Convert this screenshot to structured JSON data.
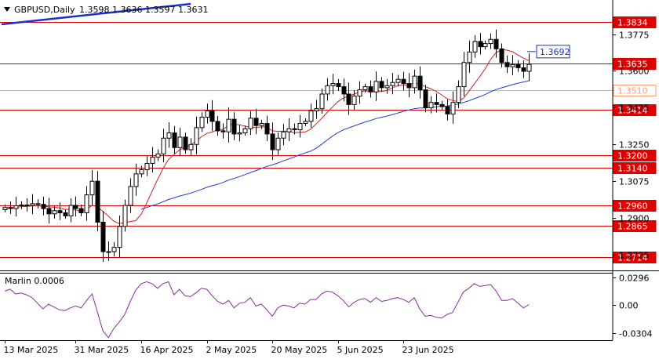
{
  "header": {
    "symbol_label": "GBPUSD,Daily",
    "ohlc_label": "1.3598 1.3636 1.3597 1.3631",
    "indicator_label": "Marlin 0.0006"
  },
  "colors": {
    "bull_candle": "#ffffff",
    "bear_candle": "#000000",
    "level_line": "#e00000",
    "level_tag": "#e00000",
    "soft_level_line": "#ff9d7a",
    "ma_fast": "#d61f1f",
    "ma_slow": "#1f3fd6",
    "trend_line": "#1a2fd0",
    "oscillator": "#8a2d9a",
    "target_tag_border": "#1a2fd0"
  },
  "chart_data": [
    {
      "type": "candlestick",
      "title": "GBPUSD,Daily",
      "ylim": [
        1.2658,
        1.393
      ],
      "y_ticks": [
        "1.3775",
        "1.3600",
        "1.3425",
        "1.3250",
        "1.3075",
        "1.2900",
        "1.2725"
      ],
      "y_tick_values": [
        1.3775,
        1.36,
        1.3425,
        1.325,
        1.3075,
        1.29,
        1.2725
      ],
      "x_labels": [
        "13 Mar 2025",
        "31 Mar 2025",
        "16 Apr 2025",
        "2 May 2025",
        "20 May 2025",
        "5 Jun 2025",
        "23 Jun 2025"
      ],
      "x_label_indices": [
        0,
        13,
        25,
        37,
        49,
        61,
        73
      ],
      "levels": [
        {
          "label": "1.3834",
          "value": 1.3834,
          "style": "strong"
        },
        {
          "label": "1.3635",
          "value": 1.3635,
          "style": "strong"
        },
        {
          "label": "1.3510",
          "value": 1.351,
          "style": "soft"
        },
        {
          "label": "1.3414",
          "value": 1.3414,
          "style": "strong"
        },
        {
          "label": "1.3200",
          "value": 1.32,
          "style": "strong"
        },
        {
          "label": "1.3140",
          "value": 1.314,
          "style": "strong"
        },
        {
          "label": "1.2960",
          "value": 1.296,
          "style": "strong"
        },
        {
          "label": "1.2865",
          "value": 1.2865,
          "style": "strong"
        },
        {
          "label": "1.2714",
          "value": 1.2714,
          "style": "strong"
        }
      ],
      "target_label": "1.3692",
      "target_value": 1.3692,
      "closes": [
        1.295,
        1.2945,
        1.2958,
        1.2962,
        1.296,
        1.2968,
        1.2965,
        1.2945,
        1.292,
        1.2935,
        1.2925,
        1.291,
        1.296,
        1.2945,
        1.2925,
        1.301,
        1.3075,
        1.288,
        1.274,
        1.274,
        1.276,
        1.286,
        1.296,
        1.305,
        1.311,
        1.313,
        1.316,
        1.319,
        1.3205,
        1.328,
        1.3305,
        1.3235,
        1.3285,
        1.3225,
        1.325,
        1.333,
        1.338,
        1.341,
        1.336,
        1.3315,
        1.331,
        1.337,
        1.33,
        1.3305,
        1.3325,
        1.3375,
        1.334,
        1.335,
        1.33,
        1.3225,
        1.328,
        1.331,
        1.3325,
        1.332,
        1.335,
        1.336,
        1.341,
        1.342,
        1.349,
        1.353,
        1.354,
        1.3525,
        1.349,
        1.344,
        1.348,
        1.351,
        1.3525,
        1.35,
        1.355,
        1.352,
        1.353,
        1.3545,
        1.356,
        1.354,
        1.352,
        1.3575,
        1.351,
        1.3425,
        1.345,
        1.344,
        1.343,
        1.3395,
        1.345,
        1.3525,
        1.364,
        1.369,
        1.374,
        1.3715,
        1.373,
        1.375,
        1.3705,
        1.364,
        1.362,
        1.363,
        1.3615,
        1.3598,
        1.3631
      ]
    },
    {
      "type": "line",
      "title": "Marlin 0.0006",
      "ylim": [
        -0.036,
        0.033
      ],
      "y_ticks": [
        "0.0296",
        "0.00",
        "-0.0304"
      ],
      "y_tick_values": [
        0.0296,
        0.0,
        -0.0304
      ],
      "series": [
        {
          "values": [
            0.015,
            0.017,
            0.012,
            0.013,
            0.011,
            0.008,
            0.002,
            -0.004,
            0.001,
            -0.002,
            -0.005,
            -0.006,
            -0.003,
            -0.001,
            -0.003,
            0.005,
            0.012,
            -0.008,
            -0.028,
            -0.035,
            -0.025,
            -0.018,
            -0.01,
            0.004,
            0.016,
            0.023,
            0.025,
            0.023,
            0.018,
            0.023,
            0.025,
            0.011,
            0.017,
            0.01,
            0.009,
            0.013,
            0.018,
            0.017,
            0.01,
            0.004,
            0.001,
            0.005,
            -0.003,
            0.002,
            0.003,
            0.008,
            -0.001,
            0.001,
            -0.005,
            -0.012,
            -0.003,
            0.0,
            -0.001,
            -0.003,
            0.002,
            0.001,
            0.006,
            0.006,
            0.012,
            0.015,
            0.014,
            0.01,
            0.005,
            -0.002,
            0.003,
            0.006,
            0.007,
            0.003,
            0.008,
            0.004,
            0.005,
            0.007,
            0.008,
            0.006,
            0.003,
            0.008,
            -0.004,
            -0.012,
            -0.011,
            -0.013,
            -0.014,
            -0.01,
            -0.008,
            0.003,
            0.014,
            0.018,
            0.023,
            0.02,
            0.021,
            0.022,
            0.015,
            0.005,
            0.005,
            0.007,
            0.002,
            -0.003,
            0.0006
          ]
        }
      ]
    }
  ]
}
